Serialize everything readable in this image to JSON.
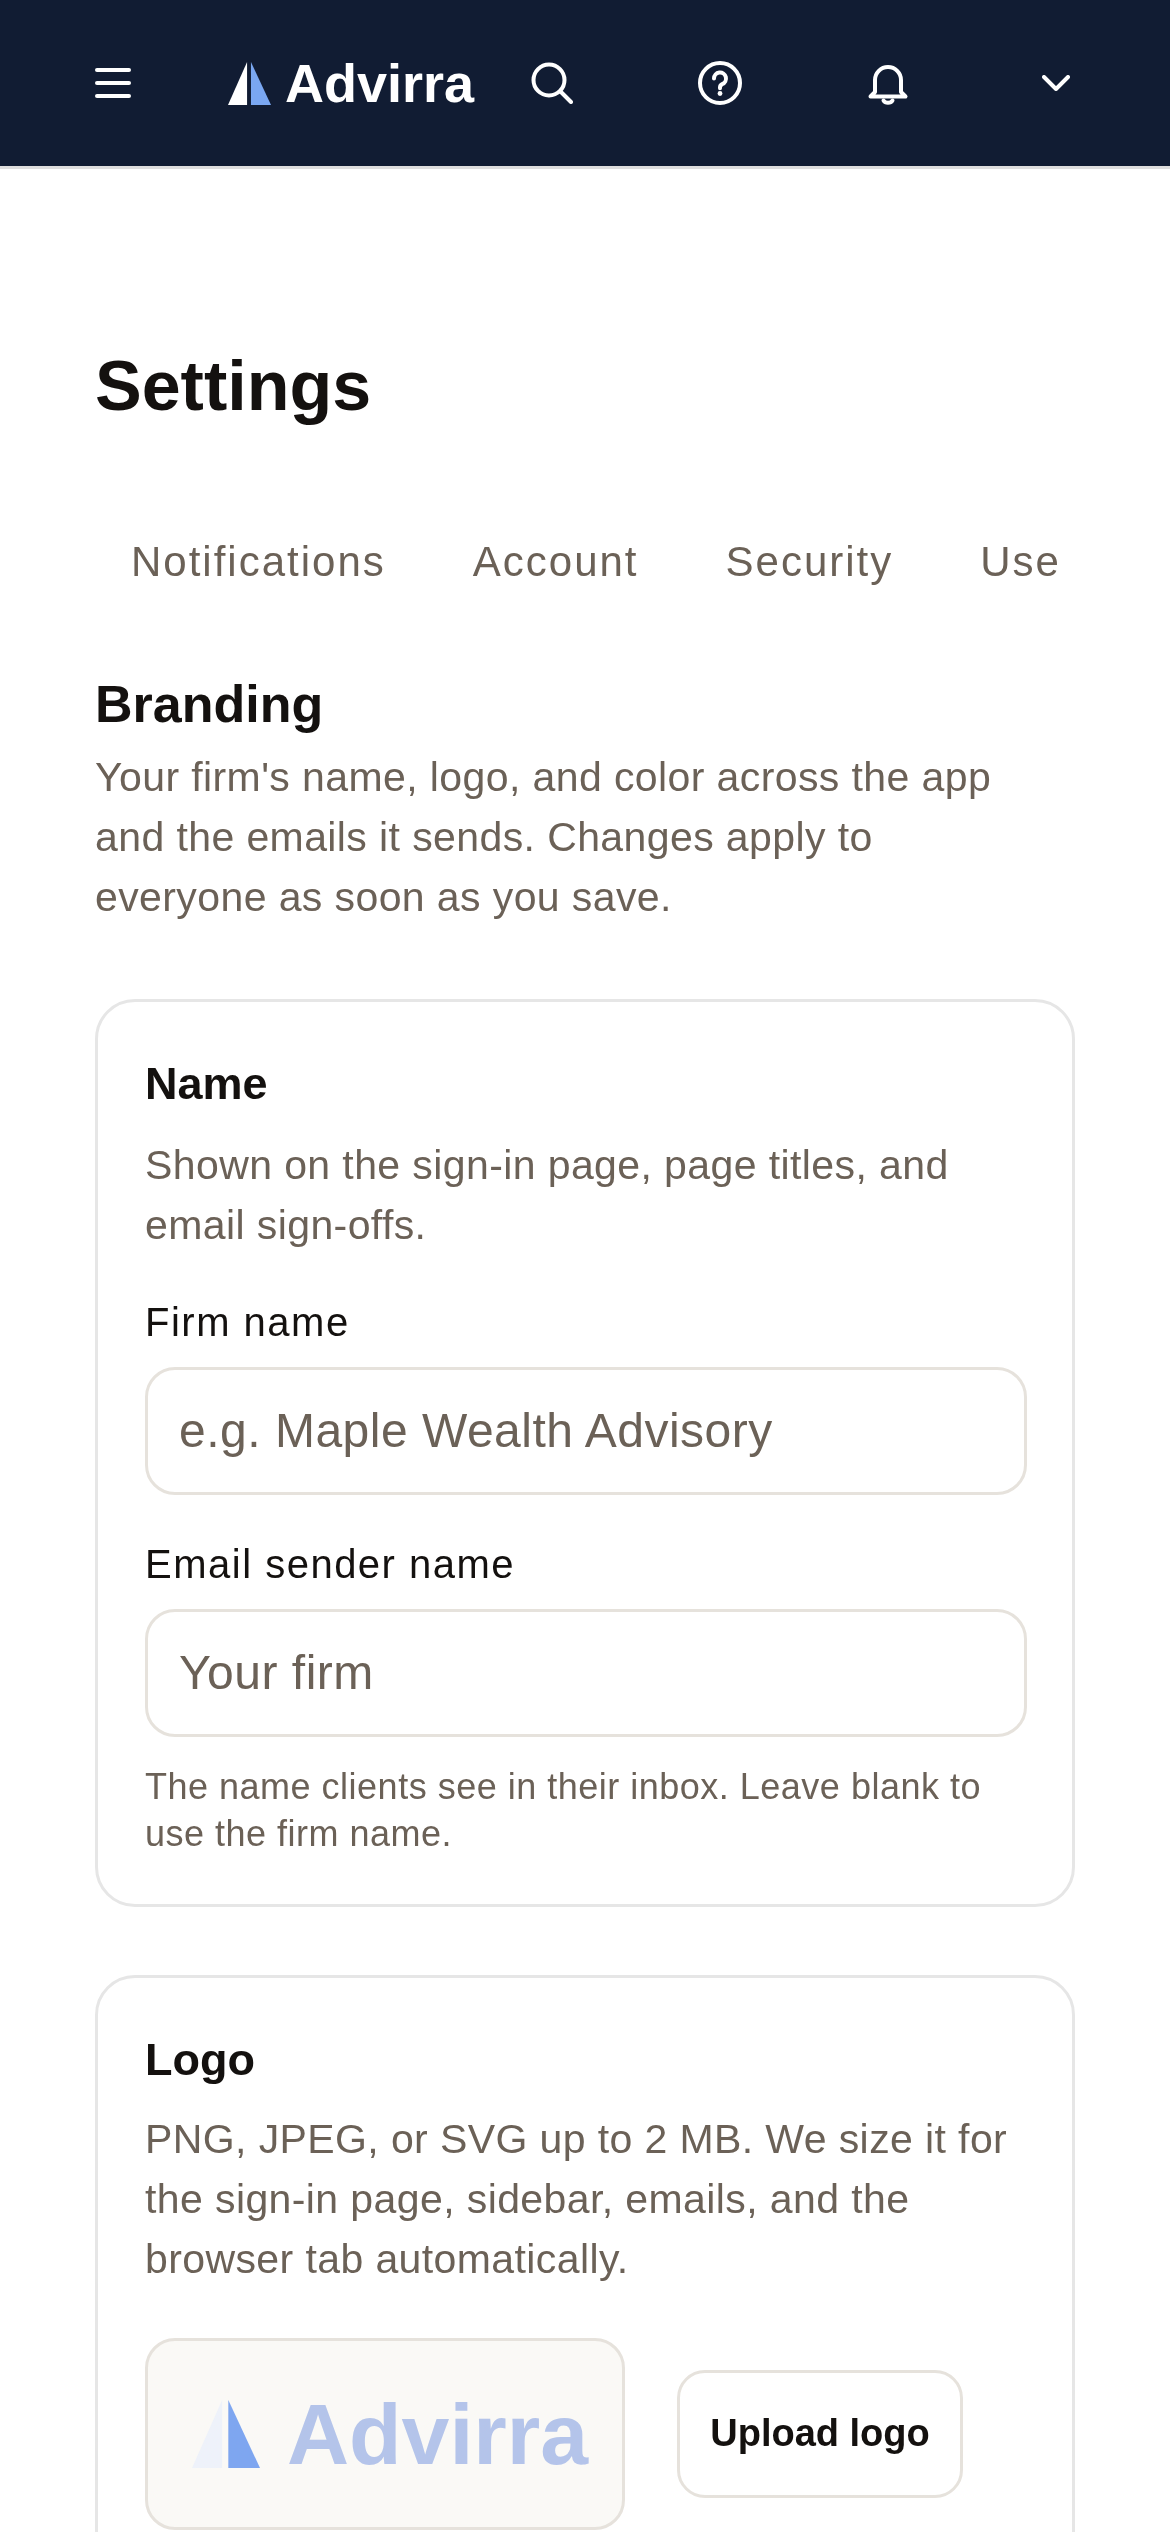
{
  "top_bar": {
    "brand": "Advirra"
  },
  "page": {
    "title": "Settings"
  },
  "tabs": [
    {
      "label": "Notifications",
      "selected": false
    },
    {
      "label": "Account",
      "selected": false
    },
    {
      "label": "Security",
      "selected": false
    },
    {
      "label": "Use",
      "selected": false
    }
  ],
  "section": {
    "title": "Branding",
    "description": "Your firm's name, logo, and color across the app and the emails it sends. Changes apply to everyone as soon as you save."
  },
  "cards": [
    {
      "kind": "name",
      "title": "Name",
      "description": "Shown on the sign-in page, page titles, and email sign-offs.",
      "fields": [
        {
          "label": "Firm name",
          "placeholder": "e.g. Maple Wealth Advisory"
        },
        {
          "label": "Email sender name",
          "placeholder": "Your firm",
          "help": "The name clients see in their inbox. Leave blank to use the firm name."
        }
      ]
    },
    {
      "kind": "logo",
      "title": "Logo",
      "description": "PNG, JPEG, or SVG up to 2 MB. We size it for the sign-in page, sidebar, emails, and the browser tab automatically.",
      "preview": {
        "wordmark": "Advirra"
      },
      "button": "Upload logo"
    }
  ]
}
